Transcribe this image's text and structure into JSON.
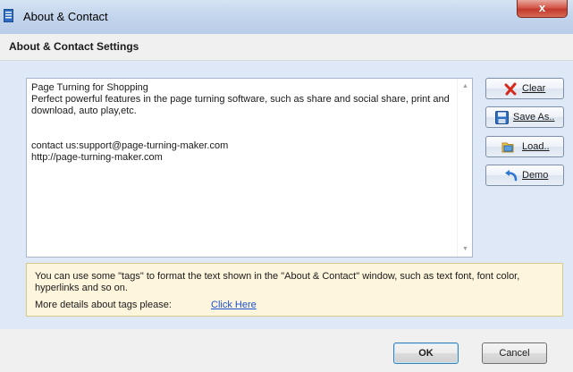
{
  "window": {
    "title": "About & Contact",
    "close_glyph": "x",
    "icon": "app-document-icon"
  },
  "header": {
    "title": "About & Contact Settings"
  },
  "editor": {
    "text": "Page Turning for Shopping\nPerfect powerful features in the page turning software, such as share and social share, print and download, auto play,etc.\n\n\ncontact us:support@page-turning-maker.com\nhttp://page-turning-maker.com"
  },
  "buttons": {
    "clear": {
      "label": "Clear",
      "icon": "red-x-icon"
    },
    "save_as": {
      "label": "Save As..",
      "icon": "floppy-disk-icon"
    },
    "load": {
      "label": "Load..",
      "icon": "folder-open-icon"
    },
    "demo": {
      "label": "Demo",
      "icon": "undo-arrow-icon"
    }
  },
  "info": {
    "text": "You can use some \"tags\" to format the text shown in the \"About & Contact\" window, such as text font, font color, hyperlinks and so on.",
    "more_label": "More details about tags please:",
    "link_label": "Click Here"
  },
  "footer": {
    "ok_label": "OK",
    "cancel_label": "Cancel"
  },
  "colors": {
    "titlebar": "#c3d5ec",
    "body_bg": "#dfe8f6",
    "info_bg": "#fdf5dc",
    "link": "#1a4fd6",
    "close": "#c23a2b"
  }
}
